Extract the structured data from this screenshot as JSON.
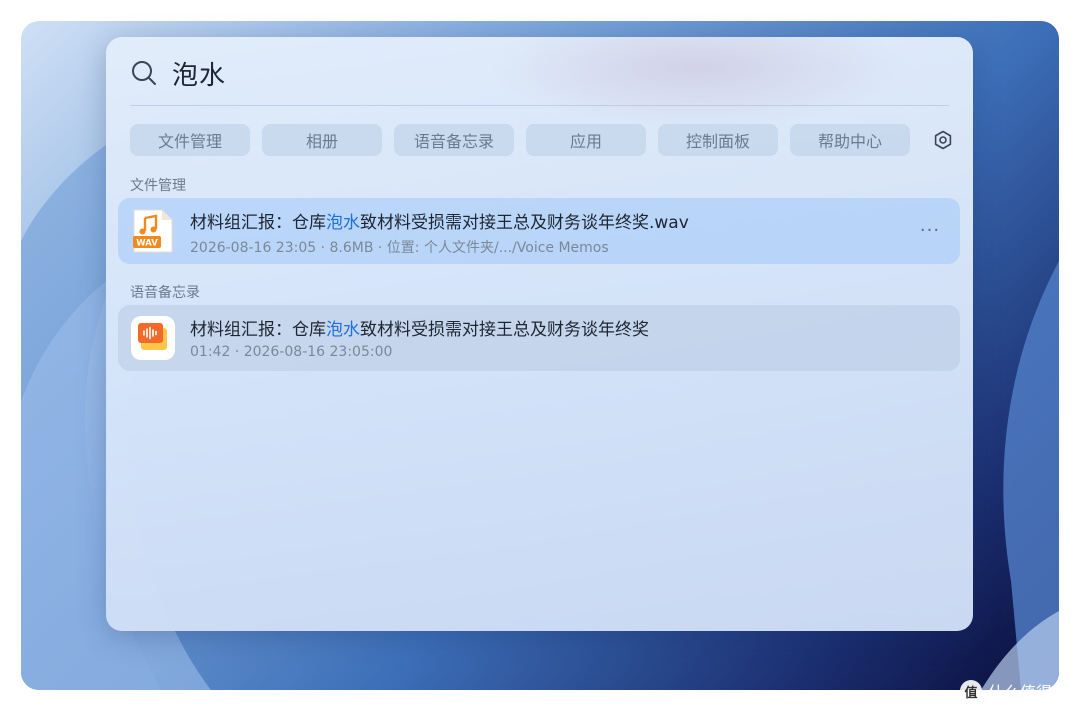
{
  "search": {
    "query": "泡水"
  },
  "filters": [
    "文件管理",
    "相册",
    "语音备忘录",
    "应用",
    "控制面板",
    "帮助中心"
  ],
  "sections": [
    {
      "label": "文件管理",
      "results": [
        {
          "icon": "wav-audio-file-icon",
          "icon_label": "WAV",
          "title_pre": "材料组汇报：仓库",
          "title_hl": "泡水",
          "title_post": "致材料受损需对接王总及财务谈年终奖.wav",
          "meta": "2026-08-16 23:05  ·  8.6MB  ·  位置: 个人文件夹/.../Voice Memos",
          "selected": true
        }
      ]
    },
    {
      "label": "语音备忘录",
      "results": [
        {
          "icon": "voice-memo-app-icon",
          "title_pre": "材料组汇报：仓库",
          "title_hl": "泡水",
          "title_post": "致材料受损需对接王总及财务谈年终奖",
          "meta": "01:42  ·  2026-08-16 23:05:00",
          "selected": false
        }
      ]
    }
  ],
  "more_label": "···",
  "watermark": {
    "badge": "值",
    "text": "什么值得买"
  },
  "colors": {
    "highlight": "#1f6fe0",
    "selected_row": "#a0c8fa",
    "chip_text": "#6c7a8e"
  }
}
